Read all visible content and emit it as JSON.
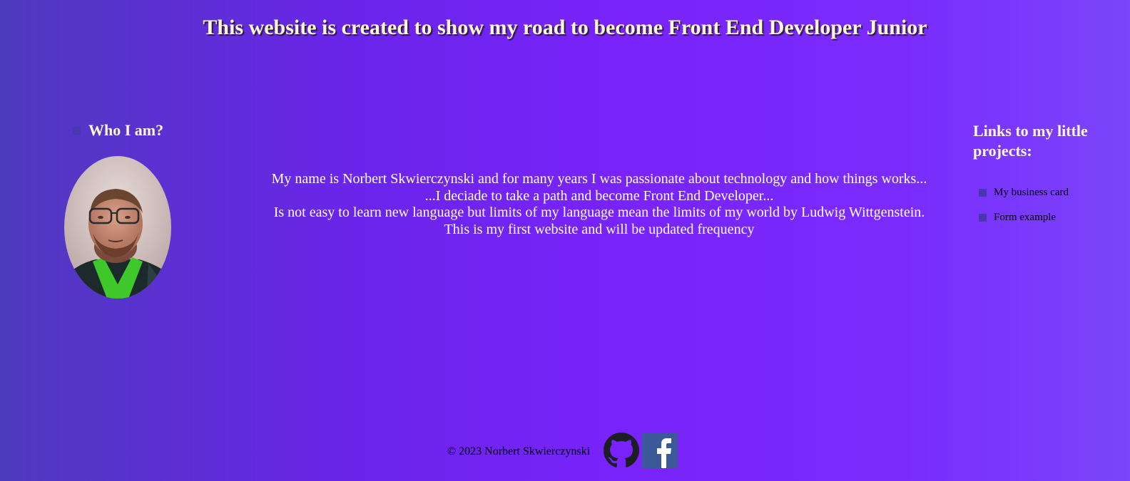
{
  "header": {
    "title": "This website is created to show my road to become Front End Developer Junior"
  },
  "about": {
    "heading": "Who I am?",
    "lines": [
      "My name is Norbert Skwierczynski and for many years I was passionate about technology and how things works...",
      "...I deciade to take a path and become Front End Developer...",
      "Is not easy to learn new language but limits of my language mean the limits of my world by Ludwig Wittgenstein.",
      "This is my first website and will be updated frequency"
    ]
  },
  "projects": {
    "heading": "Links to my little projects:",
    "links": [
      {
        "label": "My business card"
      },
      {
        "label": "Form example"
      }
    ]
  },
  "footer": {
    "copyright": "© 2023 Norbert Skwierczynski",
    "icons": [
      "github-icon",
      "facebook-icon"
    ]
  },
  "colors": {
    "heading_text": "#fff8d6",
    "bullet": "#4a36b0",
    "facebook": "#3b5998",
    "github": "#1b1f23"
  }
}
